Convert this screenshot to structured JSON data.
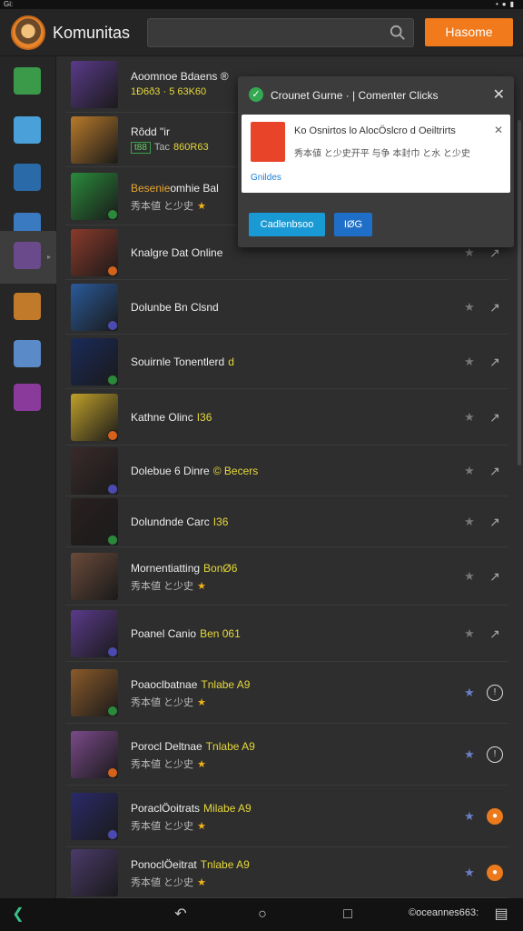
{
  "status_bar": {
    "left_text": "Gi:",
    "right_icons": [
      "dot-icon",
      "dot-icon",
      "battery-icon"
    ]
  },
  "header": {
    "app_title": "Komunitas",
    "search": {
      "placeholder": "",
      "value": ""
    },
    "action_button": "Hasome"
  },
  "sidebar": {
    "items": [
      {
        "icon": "avatar-1",
        "color": "#3a9a4a"
      },
      {
        "icon": "avatar-2",
        "color": "#4aa0d8"
      },
      {
        "icon": "avatar-3",
        "color": "#2a6aa8"
      },
      {
        "icon": "avatar-4",
        "color": "#3a7ac0"
      },
      {
        "icon": "avatar-5",
        "color": "#6a4a8a",
        "active": true
      },
      {
        "icon": "avatar-6",
        "color": "#c07a2a"
      },
      {
        "icon": "avatar-7",
        "color": "#5a8ac8"
      },
      {
        "icon": "avatar-8",
        "color": "#8a3a9a"
      }
    ]
  },
  "rows": [
    {
      "title": "Aoomnoe Bdaens ®",
      "subtitle": "1Ð6ð3 · 5 63K60",
      "thumb": "#5a3a8a",
      "badge": "",
      "star": "grey",
      "action": "grey"
    },
    {
      "title": "Rôdd \"ir",
      "tag": "t88",
      "subtitle_prefix": "Tac",
      "subtitle": "860R63",
      "thumb": "#b87a2a",
      "badge": "",
      "star": "grey",
      "action": "grey"
    },
    {
      "title_hl": "Besenie",
      "title": "omhie Bal",
      "subtitle": "秀本値 と少史",
      "stars": "★",
      "thumb": "#2a8a3a",
      "badge": "O",
      "star": "grey",
      "action": "grey"
    },
    {
      "title": "Knalgre Dat Online",
      "thumb": "#8a3a2a",
      "badge": "O",
      "star": "grey",
      "action": "grey"
    },
    {
      "title": "Dolunbe Bn Clsnd",
      "thumb": "#2a5a9a",
      "badge": "O",
      "star": "grey",
      "action": "grey"
    },
    {
      "title": "Souirnle Tonentlerd",
      "title_suffix": "d",
      "thumb": "#1a2a5a",
      "badge": "O",
      "star": "grey",
      "action": "grey"
    },
    {
      "title": "Kathne Olinc",
      "title_suffix": "I36",
      "thumb": "#c0a02a",
      "badge": "O",
      "star": "grey",
      "action": "grey"
    },
    {
      "title": "Dolebue 6 Dinre",
      "title_suffix": "© Becers",
      "thumb": "#3a2a2a",
      "badge": "O",
      "star": "grey",
      "action": "grey"
    },
    {
      "title": "Dolundnde Carc",
      "title_suffix": "I36",
      "thumb": "#2a2020",
      "badge": "O",
      "star": "grey",
      "action": "grey"
    },
    {
      "title": "Mornentiatting",
      "title_suffix": "BonØ6",
      "subtitle": "秀本値 と少史",
      "stars": "★",
      "thumb": "#6a4a3a",
      "badge": "",
      "star": "grey",
      "action": "grey"
    },
    {
      "title": "Poanel Canio",
      "title_suffix": "Ben 061",
      "thumb": "#5a3a8a",
      "badge": "O",
      "star": "grey",
      "action": "grey"
    },
    {
      "title": "Poaoclbatnae",
      "title_suffix": "Tnlabe A9",
      "subtitle": "秀本値 と少史",
      "stars": "★",
      "thumb": "#8a5a2a",
      "badge": "O",
      "star": "blue",
      "action": "circle"
    },
    {
      "title": "Porocl Deltnae",
      "title_suffix": "Tnlabe A9",
      "subtitle": "秀本値 と少史",
      "stars": "★",
      "thumb": "#7a4a8a",
      "badge": "O",
      "star": "blue",
      "action": "circle"
    },
    {
      "title": "PoraclÖoitrats",
      "title_suffix": "Milabe A9",
      "subtitle": "秀本値 と少史",
      "stars": "★",
      "thumb": "#2a2a6a",
      "badge": "O",
      "star": "blue",
      "action": "orange"
    },
    {
      "title": "PonoclÖeitrat",
      "title_suffix": "Tnlabe A9",
      "subtitle": "秀本値 と少史",
      "stars": "★",
      "thumb": "#4a3a6a",
      "badge": "",
      "star": "blue",
      "action": "orange"
    }
  ],
  "popup": {
    "title": "Crounet Gurne · | Comenter Clicks",
    "card_title": "Ko Osnirtos lo AlocÖslcro d Oeiltrirts",
    "card_subtitle": "秀本値 と少史开平 与争 本封巾 と水 と少史",
    "card_link": "Gnildes",
    "button_primary": "Cadlenbsoo",
    "button_secondary": "IØG"
  },
  "nav": {
    "right_text": "©oceannes663:"
  },
  "colors": {
    "accent": "#f07a1c",
    "popup_primary": "#1a9ad4",
    "popup_secondary": "#1f6fc8",
    "badge_green": "#34a853"
  }
}
